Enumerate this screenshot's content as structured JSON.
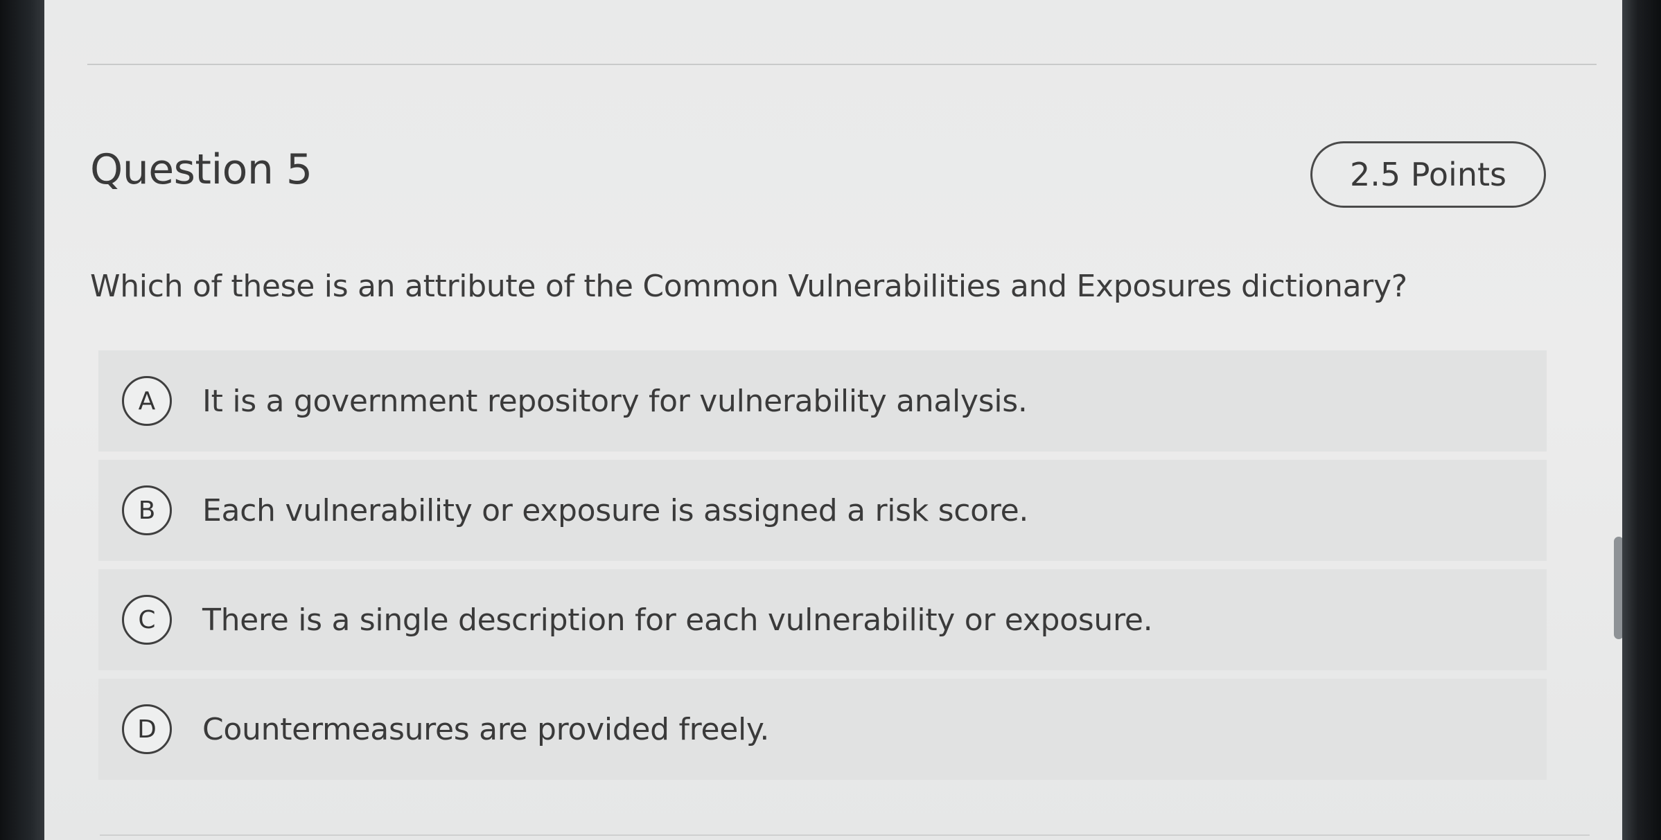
{
  "question": {
    "title": "Question 5",
    "points": "2.5 Points",
    "prompt": "Which of these is an attribute of the Common Vulnerabilities and Exposures dictionary?"
  },
  "options": [
    {
      "letter": "A",
      "text": "It is a government repository for vulnerability analysis."
    },
    {
      "letter": "B",
      "text": "Each vulnerability or exposure is assigned a risk score."
    },
    {
      "letter": "C",
      "text": "There is a single description for each vulnerability or exposure."
    },
    {
      "letter": "D",
      "text": "Countermeasures are provided freely."
    }
  ]
}
